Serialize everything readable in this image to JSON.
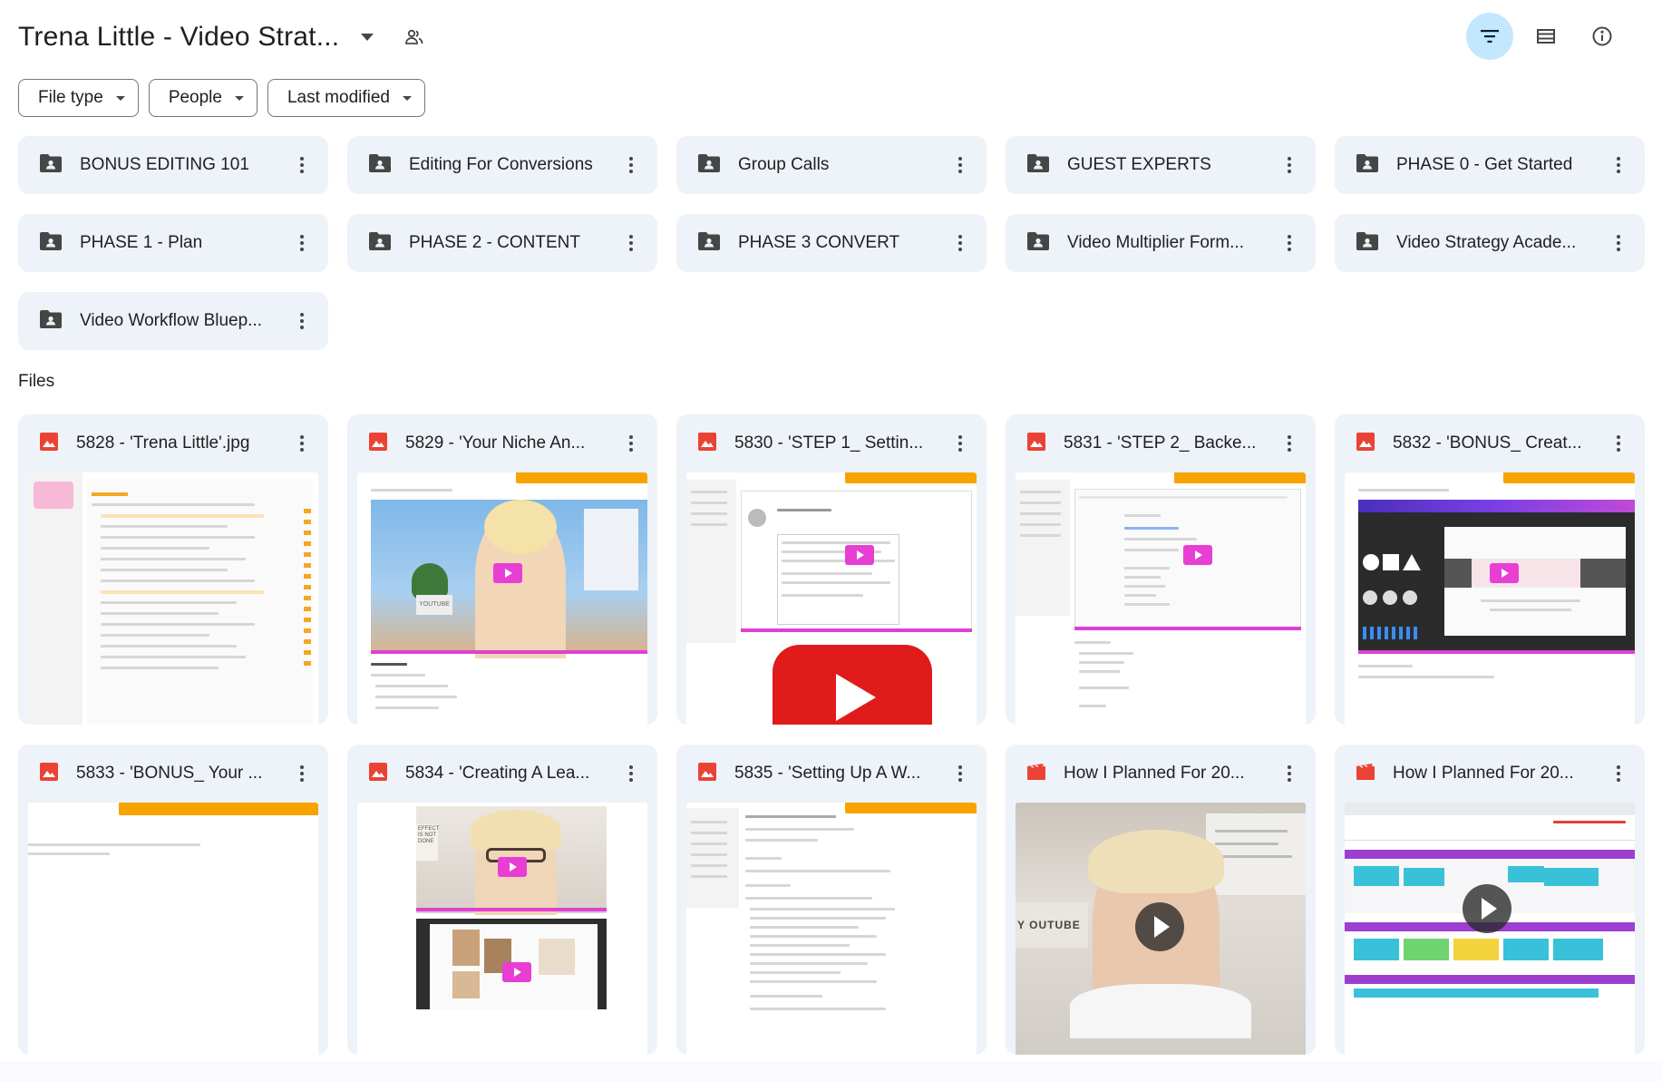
{
  "header": {
    "title": "Trena Little - Video Strat...",
    "icons": {
      "caret": "caret-down-icon",
      "shared": "shared-folder-people-icon"
    },
    "tools": [
      "filter-icon",
      "list-view-icon",
      "info-icon"
    ]
  },
  "filters": [
    {
      "label": "File type"
    },
    {
      "label": "People"
    },
    {
      "label": "Last modified"
    }
  ],
  "folders": [
    {
      "name": "BONUS EDITING 101"
    },
    {
      "name": "Editing For Conversions"
    },
    {
      "name": "Group Calls"
    },
    {
      "name": "GUEST EXPERTS"
    },
    {
      "name": "PHASE 0 - Get Started"
    },
    {
      "name": "PHASE 1 - Plan"
    },
    {
      "name": "PHASE 2 - CONTENT"
    },
    {
      "name": "PHASE 3 CONVERT"
    },
    {
      "name": "Video Multiplier Form..."
    },
    {
      "name": "Video Strategy Acade..."
    },
    {
      "name": "Video Workflow Bluep..."
    }
  ],
  "files_label": "Files",
  "files": [
    {
      "name": "5828 - 'Trena Little'.jpg",
      "type": "image"
    },
    {
      "name": "5829 - 'Your Niche An...",
      "type": "image"
    },
    {
      "name": "5830 - 'STEP 1_ Settin...",
      "type": "image"
    },
    {
      "name": "5831 - 'STEP 2_ Backe...",
      "type": "image"
    },
    {
      "name": "5832 - 'BONUS_ Creat...",
      "type": "image"
    },
    {
      "name": "5833 - 'BONUS_ Your ...",
      "type": "image"
    },
    {
      "name": "5834 - 'Creating A Lea...",
      "type": "image"
    },
    {
      "name": "5835 - 'Setting Up A W...",
      "type": "image"
    },
    {
      "name": "How I Planned For 20...",
      "type": "video"
    },
    {
      "name": "How I Planned For 20...",
      "type": "video"
    }
  ],
  "thumb_text": {
    "youtube_sign": "YOUTUBE",
    "youtube_sign2": "Y OUTUBE",
    "wall_sign": "EFFECT IS NOT DONE"
  },
  "colors": {
    "folder_bg": "#eef2f9",
    "active_tool": "#c2e7ff",
    "image_icon": "#ea4335",
    "video_icon": "#ea4335",
    "pink_accent": "#e83ed4",
    "orange_accent": "#f7a400"
  }
}
